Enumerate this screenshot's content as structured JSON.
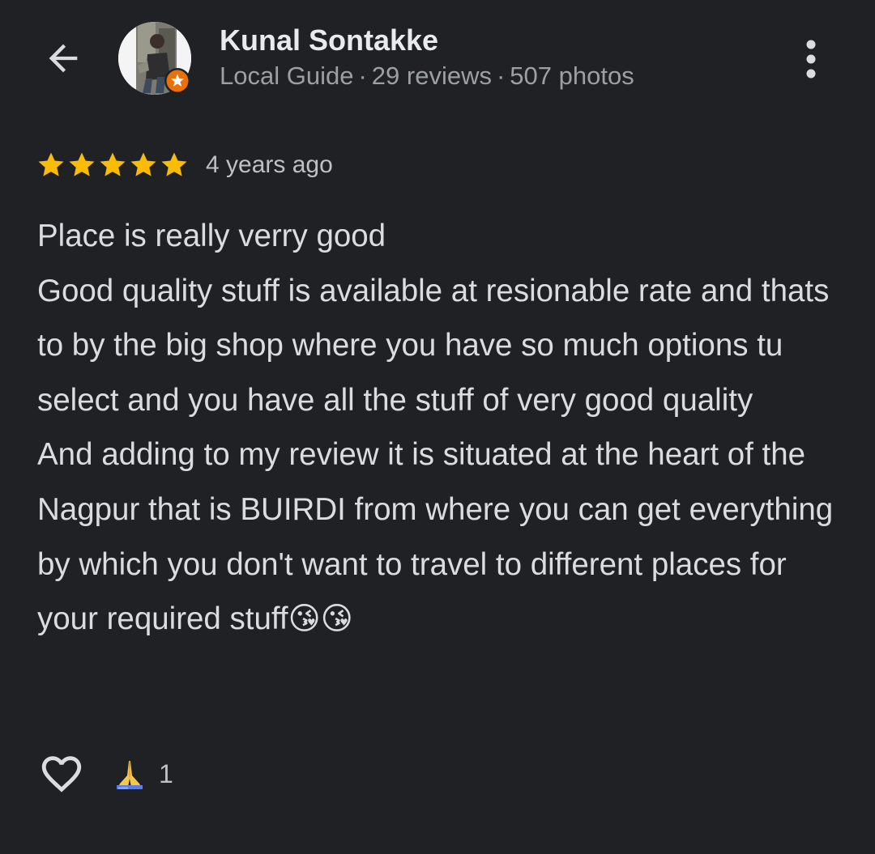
{
  "header": {
    "back_icon": "arrow-left-icon",
    "reviewer_name": "Kunal Sontakke",
    "reviewer_level": "Local Guide",
    "separator": "·",
    "reviews_count": "29 reviews",
    "photos_count": "507 photos",
    "badge_icon": "local-guide-star-badge",
    "more_icon": "more-vertical-icon"
  },
  "review": {
    "rating": 5,
    "rating_max": 5,
    "date": "4 years ago",
    "text": "Place is really verry good\nGood quality stuff is available at resionable rate and thats to by the big shop where you have so much options tu select and you have all the stuff of very good quality\nAnd adding to my review it is situated at the heart of the Nagpur that is BUIRDI from where you can get everything by which you don't want to travel to different places for your required stuff😘😘"
  },
  "actions": {
    "like_icon": "heart-outline-icon",
    "reaction_emoji": "🙏",
    "reaction_count": "1"
  },
  "colors": {
    "background": "#202124",
    "star": "#fbbc04",
    "badge": "#e8710a",
    "primary_text": "#e8eaed",
    "secondary_text": "#9aa0a6"
  }
}
